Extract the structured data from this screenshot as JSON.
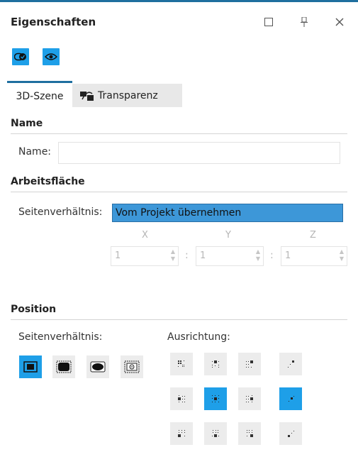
{
  "window": {
    "title": "Eigenschaften",
    "maximize_icon": "square-icon",
    "pin_icon": "pin-icon",
    "close_icon": "close-icon"
  },
  "toolbar": {
    "buttons": [
      {
        "icon": "toggle-check-icon",
        "active": true
      },
      {
        "icon": "eye-icon",
        "active": true
      }
    ]
  },
  "tabs": [
    {
      "label": "3D-Szene",
      "active": true
    },
    {
      "label": "Transparenz",
      "icon": "transparency-icon",
      "active": false
    }
  ],
  "sections": {
    "name": {
      "title": "Name",
      "field_label": "Name:",
      "field_value": ""
    },
    "workspace": {
      "title": "Arbeitsfläche",
      "aspect_label": "Seitenverhältnis:",
      "aspect_value": "Vom Projekt übernehmen",
      "axes": [
        {
          "label": "X",
          "value": "1"
        },
        {
          "label": "Y",
          "value": "1"
        },
        {
          "label": "Z",
          "value": "1"
        }
      ],
      "separator": ":"
    },
    "position": {
      "title": "Position",
      "aspect_label": "Seitenverhältnis:",
      "aspect_buttons": [
        {
          "icon": "fit-icon",
          "selected": true
        },
        {
          "icon": "fill-icon",
          "selected": false
        },
        {
          "icon": "ellipse-icon",
          "selected": false
        },
        {
          "icon": "center-crop-icon",
          "selected": false
        }
      ],
      "align_label": "Ausrichtung:",
      "align_grid": [
        [
          "top-left",
          "top-center",
          "top-right",
          "top-corner"
        ],
        [
          "middle-left",
          "middle-center",
          "middle-right",
          "middle-corner"
        ],
        [
          "bottom-left",
          "bottom-center",
          "bottom-right",
          "bottom-corner"
        ]
      ],
      "selected_align": [
        "middle-center",
        "middle-corner"
      ]
    }
  },
  "colors": {
    "accent": "#1e9fe8",
    "tab_underline": "#1f6f9f",
    "select_bg": "#3d97d8"
  }
}
